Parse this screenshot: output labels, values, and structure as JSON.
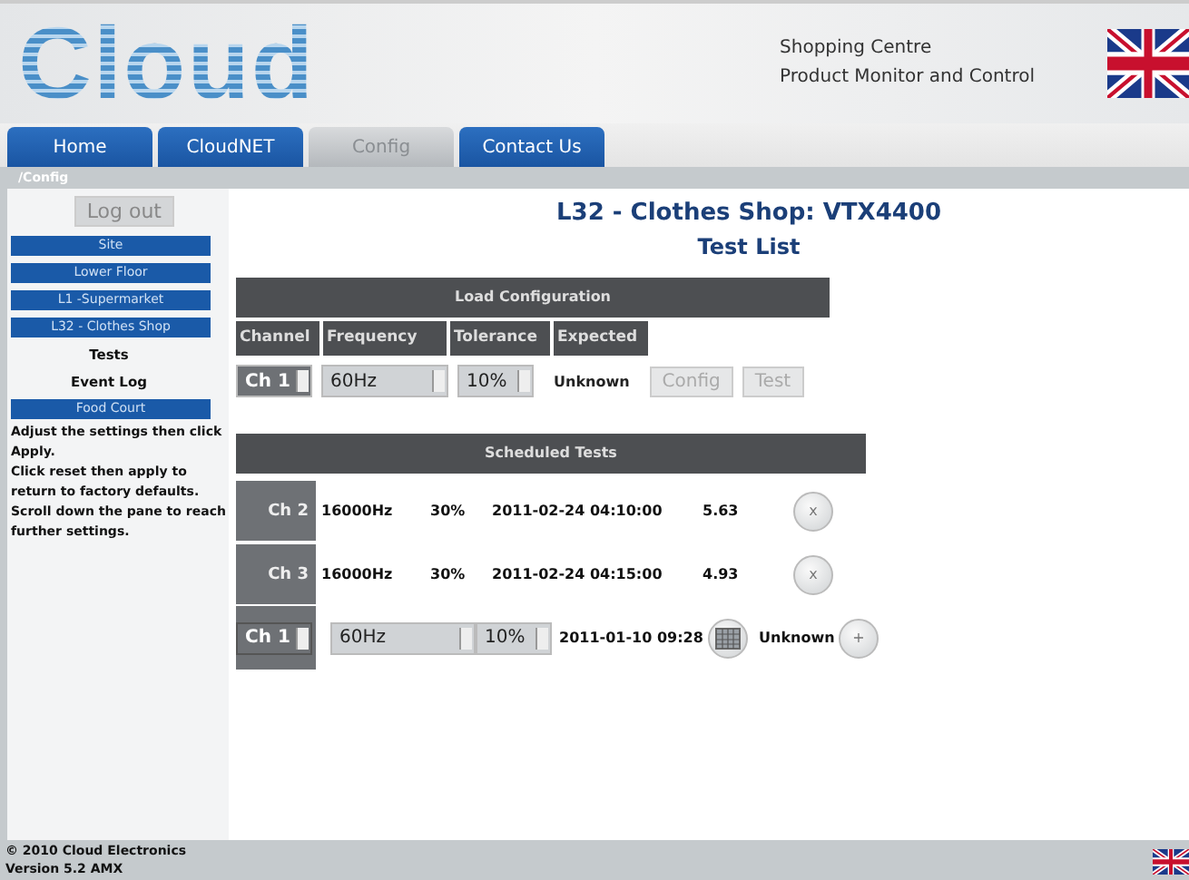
{
  "header": {
    "logo": "Cloud",
    "lines": [
      "Shopping Centre",
      "Product Monitor and Control"
    ]
  },
  "tabs": [
    {
      "label": "Home",
      "selected": false
    },
    {
      "label": "CloudNET",
      "selected": false
    },
    {
      "label": "Config",
      "selected": true
    },
    {
      "label": "Contact Us",
      "selected": false
    }
  ],
  "breadcrumb": "/Config",
  "sidebar": {
    "logout": "Log out",
    "items": [
      {
        "label": "Site",
        "kind": "nav"
      },
      {
        "label": "Lower Floor",
        "kind": "nav"
      },
      {
        "label": "L1 -Supermarket",
        "kind": "nav"
      },
      {
        "label": "L32 - Clothes Shop",
        "kind": "nav"
      },
      {
        "label": "Tests",
        "kind": "sub"
      },
      {
        "label": "Event Log",
        "kind": "sub"
      },
      {
        "label": "Food Court",
        "kind": "nav"
      }
    ],
    "help": [
      "Adjust the settings then click Apply.",
      "Click reset then apply to return to factory defaults.",
      "Scroll down the pane to reach further settings."
    ]
  },
  "heading": "L32 - Clothes Shop: VTX4400",
  "subheading": "Test List",
  "load_configuration": {
    "title": "Load Configuration",
    "columns": [
      "Channel",
      "Frequency",
      "Tolerance",
      "Expected"
    ],
    "channel": "Ch 1",
    "frequency": "60Hz",
    "tolerance": "10%",
    "expected": "Unknown",
    "buttons": [
      {
        "label": "Config",
        "disabled": true
      },
      {
        "label": "Test",
        "disabled": true
      }
    ]
  },
  "scheduled_tests": {
    "title": "Scheduled Tests",
    "rows": [
      {
        "kind": "scheduled",
        "channel": "Ch 2",
        "frequency": "16000Hz",
        "tolerance": "30%",
        "time": "2011-02-24 04:10:00",
        "result": "5.63",
        "action": "x"
      },
      {
        "kind": "scheduled",
        "channel": "Ch 3",
        "frequency": "16000Hz",
        "tolerance": "30%",
        "time": "2011-02-24 04:15:00",
        "result": "4.93",
        "action": "x"
      },
      {
        "kind": "new",
        "channel": "Ch 1",
        "frequency": "60Hz",
        "tolerance": "10%",
        "time": "2011-01-10 09:28",
        "result": "Unknown",
        "action": "+"
      }
    ]
  },
  "footer": {
    "copyright": "© 2010 Cloud Electronics",
    "version": "Version 5.2 AMX"
  }
}
